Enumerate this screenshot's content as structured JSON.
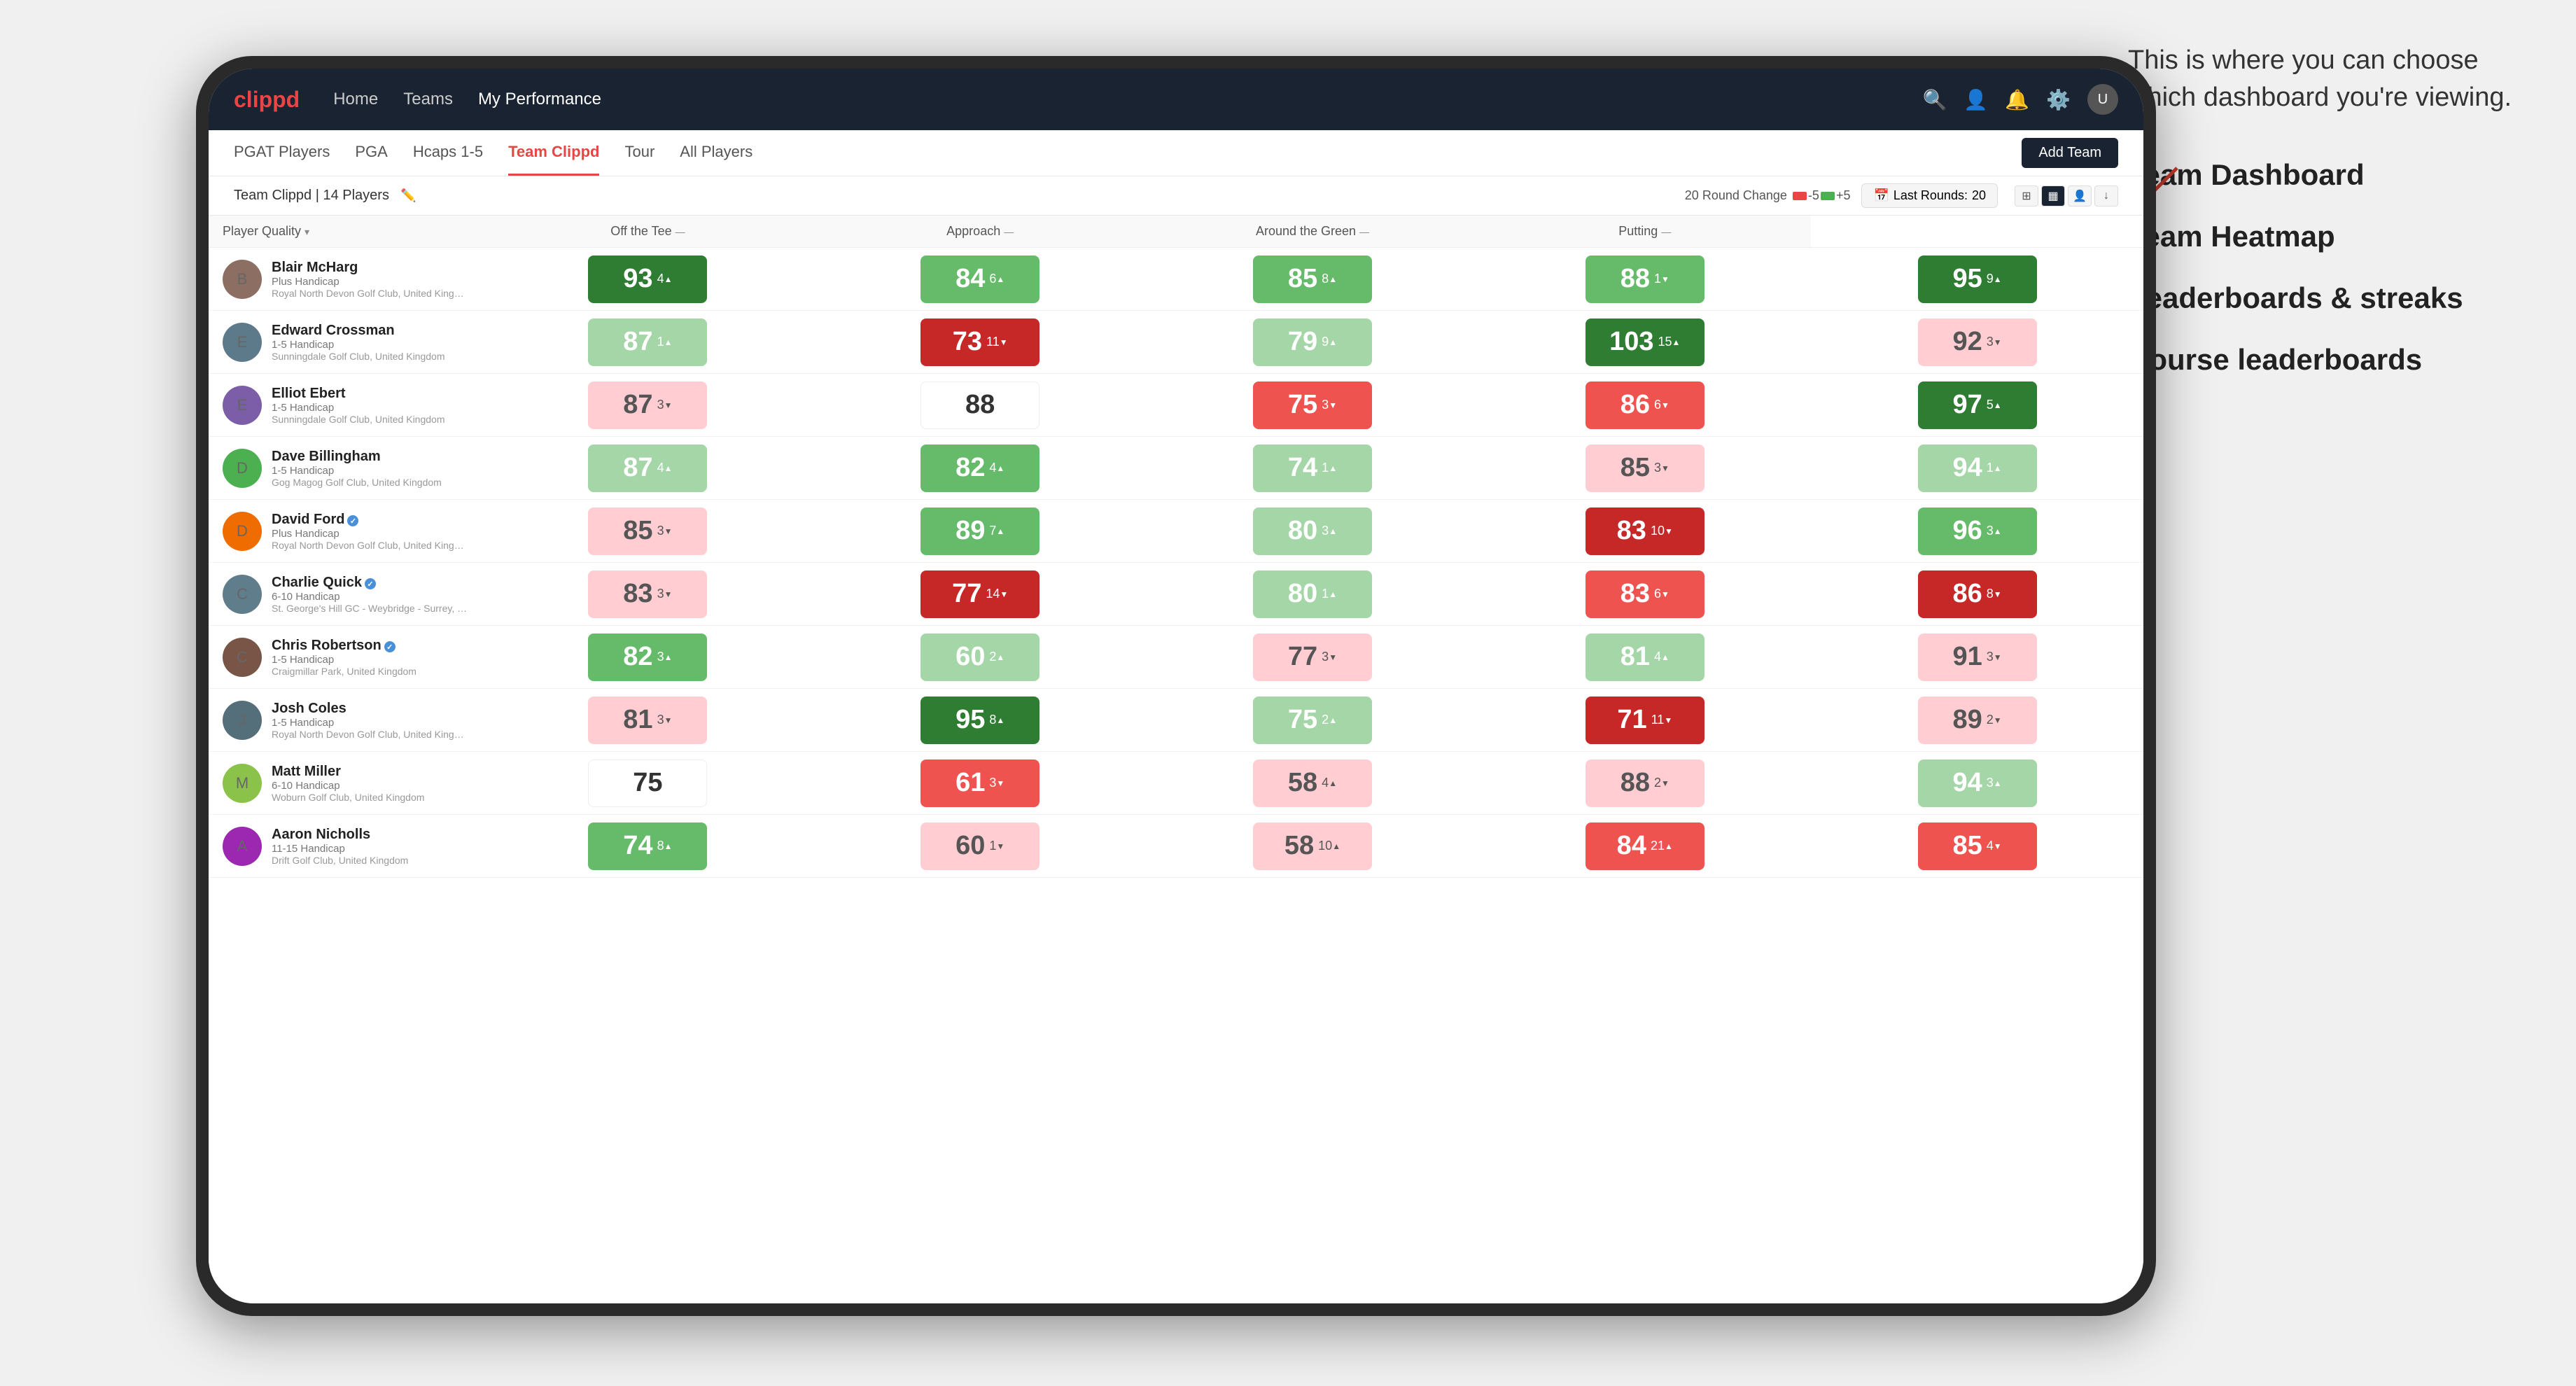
{
  "annotation": {
    "text": "This is where you can choose which dashboard you're viewing.",
    "menu_items": [
      {
        "label": "Team Dashboard"
      },
      {
        "label": "Team Heatmap"
      },
      {
        "label": "Leaderboards & streaks"
      },
      {
        "label": "Course leaderboards"
      }
    ]
  },
  "nav": {
    "logo": "clippd",
    "links": [
      {
        "label": "Home",
        "active": false
      },
      {
        "label": "Teams",
        "active": false
      },
      {
        "label": "My Performance",
        "active": true
      }
    ],
    "icons": [
      "search",
      "person",
      "bell",
      "settings"
    ]
  },
  "sub_nav": {
    "links": [
      {
        "label": "PGAT Players",
        "active": false
      },
      {
        "label": "PGA",
        "active": false
      },
      {
        "label": "Hcaps 1-5",
        "active": false
      },
      {
        "label": "Team Clippd",
        "active": true
      },
      {
        "label": "Tour",
        "active": false
      },
      {
        "label": "All Players",
        "active": false
      }
    ],
    "add_team_label": "Add Team"
  },
  "team_header": {
    "name": "Team Clippd | 14 Players",
    "round_change_label": "20 Round Change",
    "change_neg": "-5",
    "change_pos": "+5",
    "last_rounds_label": "Last Rounds:",
    "last_rounds_value": "20"
  },
  "table": {
    "columns": [
      {
        "label": "Player Quality",
        "key": "player_quality"
      },
      {
        "label": "Off the Tee",
        "key": "off_tee"
      },
      {
        "label": "Approach",
        "key": "approach"
      },
      {
        "label": "Around the Green",
        "key": "around_green"
      },
      {
        "label": "Putting",
        "key": "putting"
      }
    ],
    "rows": [
      {
        "name": "Blair McHarg",
        "handicap": "Plus Handicap",
        "club": "Royal North Devon Golf Club, United Kingdom",
        "avatar_initial": "B",
        "avatar_color": "#8d6e63",
        "scores": [
          {
            "value": 93,
            "change": 4,
            "dir": "up",
            "color": "green-dark"
          },
          {
            "value": 84,
            "change": 6,
            "dir": "up",
            "color": "green-mid"
          },
          {
            "value": 85,
            "change": 8,
            "dir": "up",
            "color": "green-mid"
          },
          {
            "value": 88,
            "change": 1,
            "dir": "down",
            "color": "green-mid"
          },
          {
            "value": 95,
            "change": 9,
            "dir": "up",
            "color": "green-dark"
          }
        ]
      },
      {
        "name": "Edward Crossman",
        "handicap": "1-5 Handicap",
        "club": "Sunningdale Golf Club, United Kingdom",
        "avatar_initial": "E",
        "avatar_color": "#5d7a8a",
        "scores": [
          {
            "value": 87,
            "change": 1,
            "dir": "up",
            "color": "green-light"
          },
          {
            "value": 73,
            "change": 11,
            "dir": "down",
            "color": "red-dark"
          },
          {
            "value": 79,
            "change": 9,
            "dir": "up",
            "color": "green-light"
          },
          {
            "value": 103,
            "change": 15,
            "dir": "up",
            "color": "green-dark"
          },
          {
            "value": 92,
            "change": 3,
            "dir": "down",
            "color": "red-light"
          }
        ]
      },
      {
        "name": "Elliot Ebert",
        "handicap": "1-5 Handicap",
        "club": "Sunningdale Golf Club, United Kingdom",
        "avatar_initial": "E",
        "avatar_color": "#7b5ea7",
        "scores": [
          {
            "value": 87,
            "change": 3,
            "dir": "down",
            "color": "red-light"
          },
          {
            "value": 88,
            "change": 0,
            "dir": "none",
            "color": "neutral"
          },
          {
            "value": 75,
            "change": 3,
            "dir": "down",
            "color": "red-mid"
          },
          {
            "value": 86,
            "change": 6,
            "dir": "down",
            "color": "red-mid"
          },
          {
            "value": 97,
            "change": 5,
            "dir": "up",
            "color": "green-dark"
          }
        ]
      },
      {
        "name": "Dave Billingham",
        "handicap": "1-5 Handicap",
        "club": "Gog Magog Golf Club, United Kingdom",
        "avatar_initial": "D",
        "avatar_color": "#4caf50",
        "scores": [
          {
            "value": 87,
            "change": 4,
            "dir": "up",
            "color": "green-light"
          },
          {
            "value": 82,
            "change": 4,
            "dir": "up",
            "color": "green-mid"
          },
          {
            "value": 74,
            "change": 1,
            "dir": "up",
            "color": "green-light"
          },
          {
            "value": 85,
            "change": 3,
            "dir": "down",
            "color": "red-light"
          },
          {
            "value": 94,
            "change": 1,
            "dir": "up",
            "color": "green-light"
          }
        ]
      },
      {
        "name": "David Ford",
        "handicap": "Plus Handicap",
        "club": "Royal North Devon Golf Club, United Kingdom",
        "avatar_initial": "D",
        "avatar_color": "#ef6c00",
        "verified": true,
        "scores": [
          {
            "value": 85,
            "change": 3,
            "dir": "down",
            "color": "red-light"
          },
          {
            "value": 89,
            "change": 7,
            "dir": "up",
            "color": "green-mid"
          },
          {
            "value": 80,
            "change": 3,
            "dir": "up",
            "color": "green-light"
          },
          {
            "value": 83,
            "change": 10,
            "dir": "down",
            "color": "red-dark"
          },
          {
            "value": 96,
            "change": 3,
            "dir": "up",
            "color": "green-mid"
          }
        ]
      },
      {
        "name": "Charlie Quick",
        "handicap": "6-10 Handicap",
        "club": "St. George's Hill GC - Weybridge - Surrey, Uni...",
        "avatar_initial": "C",
        "avatar_color": "#607d8b",
        "verified": true,
        "scores": [
          {
            "value": 83,
            "change": 3,
            "dir": "down",
            "color": "red-light"
          },
          {
            "value": 77,
            "change": 14,
            "dir": "down",
            "color": "red-dark"
          },
          {
            "value": 80,
            "change": 1,
            "dir": "up",
            "color": "green-light"
          },
          {
            "value": 83,
            "change": 6,
            "dir": "down",
            "color": "red-mid"
          },
          {
            "value": 86,
            "change": 8,
            "dir": "down",
            "color": "red-dark"
          }
        ]
      },
      {
        "name": "Chris Robertson",
        "handicap": "1-5 Handicap",
        "club": "Craigmillar Park, United Kingdom",
        "avatar_initial": "C",
        "avatar_color": "#795548",
        "verified": true,
        "scores": [
          {
            "value": 82,
            "change": 3,
            "dir": "up",
            "color": "green-mid"
          },
          {
            "value": 60,
            "change": 2,
            "dir": "up",
            "color": "green-light"
          },
          {
            "value": 77,
            "change": 3,
            "dir": "down",
            "color": "red-light"
          },
          {
            "value": 81,
            "change": 4,
            "dir": "up",
            "color": "green-light"
          },
          {
            "value": 91,
            "change": 3,
            "dir": "down",
            "color": "red-light"
          }
        ]
      },
      {
        "name": "Josh Coles",
        "handicap": "1-5 Handicap",
        "club": "Royal North Devon Golf Club, United Kingdom",
        "avatar_initial": "J",
        "avatar_color": "#546e7a",
        "scores": [
          {
            "value": 81,
            "change": 3,
            "dir": "down",
            "color": "red-light"
          },
          {
            "value": 95,
            "change": 8,
            "dir": "up",
            "color": "green-dark"
          },
          {
            "value": 75,
            "change": 2,
            "dir": "up",
            "color": "green-light"
          },
          {
            "value": 71,
            "change": 11,
            "dir": "down",
            "color": "red-dark"
          },
          {
            "value": 89,
            "change": 2,
            "dir": "down",
            "color": "red-light"
          }
        ]
      },
      {
        "name": "Matt Miller",
        "handicap": "6-10 Handicap",
        "club": "Woburn Golf Club, United Kingdom",
        "avatar_initial": "M",
        "avatar_color": "#8bc34a",
        "scores": [
          {
            "value": 75,
            "change": 0,
            "dir": "none",
            "color": "neutral"
          },
          {
            "value": 61,
            "change": 3,
            "dir": "down",
            "color": "red-mid"
          },
          {
            "value": 58,
            "change": 4,
            "dir": "up",
            "color": "red-light"
          },
          {
            "value": 88,
            "change": 2,
            "dir": "down",
            "color": "red-light"
          },
          {
            "value": 94,
            "change": 3,
            "dir": "up",
            "color": "green-light"
          }
        ]
      },
      {
        "name": "Aaron Nicholls",
        "handicap": "11-15 Handicap",
        "club": "Drift Golf Club, United Kingdom",
        "avatar_initial": "A",
        "avatar_color": "#9c27b0",
        "scores": [
          {
            "value": 74,
            "change": 8,
            "dir": "up",
            "color": "green-mid"
          },
          {
            "value": 60,
            "change": 1,
            "dir": "down",
            "color": "red-light"
          },
          {
            "value": 58,
            "change": 10,
            "dir": "up",
            "color": "red-light"
          },
          {
            "value": 84,
            "change": 21,
            "dir": "up",
            "color": "red-mid"
          },
          {
            "value": 85,
            "change": 4,
            "dir": "down",
            "color": "red-mid"
          }
        ]
      }
    ]
  }
}
